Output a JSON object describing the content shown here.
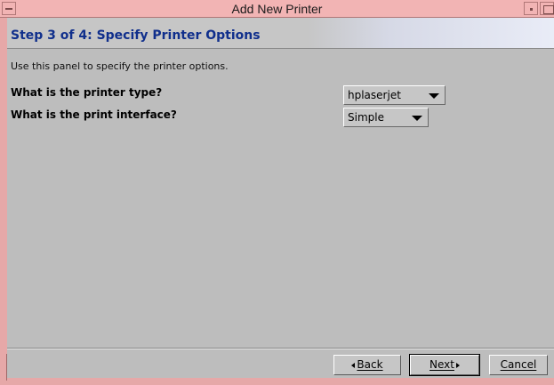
{
  "window": {
    "title": "Add New Printer"
  },
  "step": {
    "title": "Step 3 of 4: Specify Printer Options"
  },
  "panel": {
    "description": "Use this panel to specify the printer options."
  },
  "questions": [
    {
      "label": "What is the printer type?",
      "selected": "hplaserjet"
    },
    {
      "label": "What is the print interface?",
      "selected": "Simple"
    }
  ],
  "buttons": {
    "back": "Back",
    "next": "Next",
    "cancel": "Cancel"
  },
  "colors": {
    "titlebar": "#f2b4b4",
    "step_title": "#102f8c",
    "panel_bg": "#bdbdbd"
  },
  "icons": {
    "window_menu": "window-menu-icon",
    "minimize": "minimize-icon",
    "maximize": "maximize-icon",
    "dropdown": "chevron-down-icon",
    "back": "arrow-left-icon",
    "next": "arrow-right-icon"
  }
}
